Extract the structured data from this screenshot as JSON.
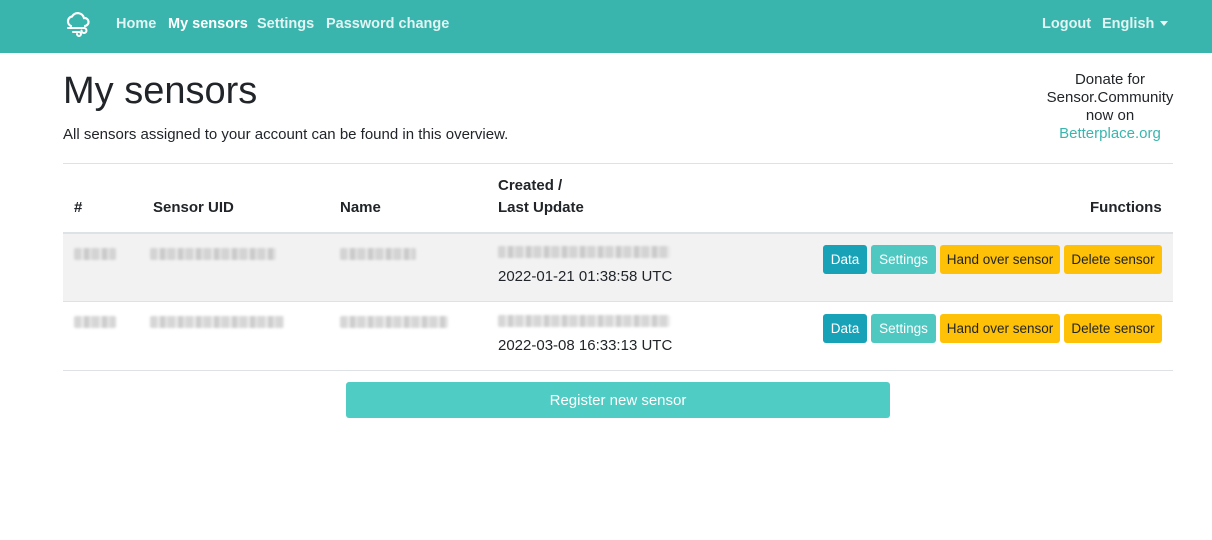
{
  "nav": {
    "logo_icon": "cloud-wind-icon",
    "home": "Home",
    "my_sensors": "My sensors",
    "settings": "Settings",
    "password_change": "Password change",
    "logout": "Logout",
    "language": "English",
    "brand_color": "#3ab5ad"
  },
  "page": {
    "title": "My sensors",
    "subtitle": "All sensors assigned to your account can be found in this overview."
  },
  "donate": {
    "line1": "Donate for",
    "line2": "Sensor.Community",
    "line3": "now on",
    "link": "Betterplace.org"
  },
  "table": {
    "headers": {
      "number": "#",
      "uid": "Sensor UID",
      "name": "Name",
      "created_line1": "Created /",
      "created_line2": "Last Update",
      "functions": "Functions"
    },
    "rows": [
      {
        "last_update": "2022-01-21 01:38:58 UTC"
      },
      {
        "last_update": "2022-03-08 16:33:13 UTC"
      }
    ],
    "buttons": {
      "data": "Data",
      "settings": "Settings",
      "hand_over": "Hand over sensor",
      "delete": "Delete sensor"
    }
  },
  "register_button": "Register new sensor"
}
